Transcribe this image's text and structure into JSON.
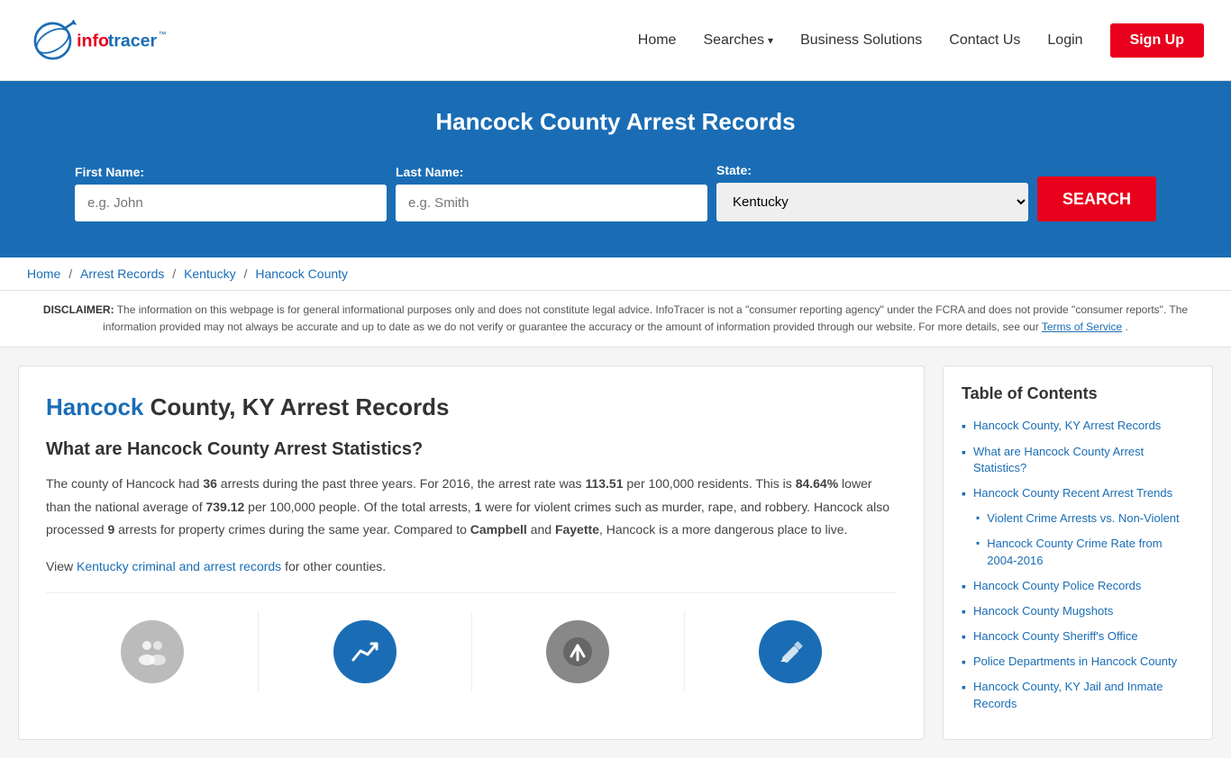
{
  "header": {
    "logo_text_info": "info",
    "logo_text_tracer": "tracer",
    "logo_tm": "™",
    "nav": {
      "home": "Home",
      "searches": "Searches",
      "business_solutions": "Business Solutions",
      "contact_us": "Contact Us",
      "login": "Login",
      "signup": "Sign Up"
    }
  },
  "hero": {
    "title": "Hancock County Arrest Records",
    "form": {
      "first_name_label": "First Name:",
      "first_name_placeholder": "e.g. John",
      "last_name_label": "Last Name:",
      "last_name_placeholder": "e.g. Smith",
      "state_label": "State:",
      "state_value": "Kentucky",
      "search_button": "SEARCH"
    }
  },
  "breadcrumb": {
    "home": "Home",
    "arrest_records": "Arrest Records",
    "kentucky": "Kentucky",
    "county": "Hancock County"
  },
  "disclaimer": {
    "label": "DISCLAIMER:",
    "text": "The information on this webpage is for general informational purposes only and does not constitute legal advice. InfoTracer is not a \"consumer reporting agency\" under the FCRA and does not provide \"consumer reports\". The information provided may not always be accurate and up to date as we do not verify or guarantee the accuracy or the amount of information provided through our website. For more details, see our",
    "tos_link": "Terms of Service",
    "period": "."
  },
  "main": {
    "title_hancock": "Hancock",
    "title_rest": " County, KY Arrest Records",
    "section1_heading": "What are Hancock County Arrest Statistics?",
    "paragraph1": "The county of Hancock had 36 arrests during the past three years. For 2016, the arrest rate was 113.51 per 100,000 residents. This is 84.64% lower than the national average of 739.12 per 100,000 people. Of the total arrests, 1 were for violent crimes such as murder, rape, and robbery. Hancock also processed 9 arrests for property crimes during the same year. Compared to Campbell and Fayette, Hancock is a more dangerous place to live.",
    "view_link_text": "Kentucky criminal and arrest records",
    "view_prefix": "View ",
    "view_suffix": " for other counties.",
    "bold_arrests": "36",
    "bold_rate": "113.51",
    "bold_pct": "84.64%",
    "bold_nat_avg": "739.12",
    "bold_violent": "1",
    "bold_property": "9",
    "bold_campbell": "Campbell",
    "bold_fayette": "Fayette"
  },
  "toc": {
    "heading": "Table of Contents",
    "items": [
      {
        "label": "Hancock County, KY Arrest Records",
        "sub": false
      },
      {
        "label": "What are Hancock County Arrest Statistics?",
        "sub": false
      },
      {
        "label": "Hancock County Recent Arrest Trends",
        "sub": false
      },
      {
        "label": "Violent Crime Arrests vs. Non-Violent",
        "sub": true
      },
      {
        "label": "Hancock County Crime Rate from 2004-2016",
        "sub": true
      },
      {
        "label": "Hancock County Police Records",
        "sub": false
      },
      {
        "label": "Hancock County Mugshots",
        "sub": false
      },
      {
        "label": "Hancock County Sheriff's Office",
        "sub": false
      },
      {
        "label": "Police Departments in Hancock County",
        "sub": false
      },
      {
        "label": "Hancock County, KY Jail and Inmate Records",
        "sub": false
      }
    ]
  }
}
